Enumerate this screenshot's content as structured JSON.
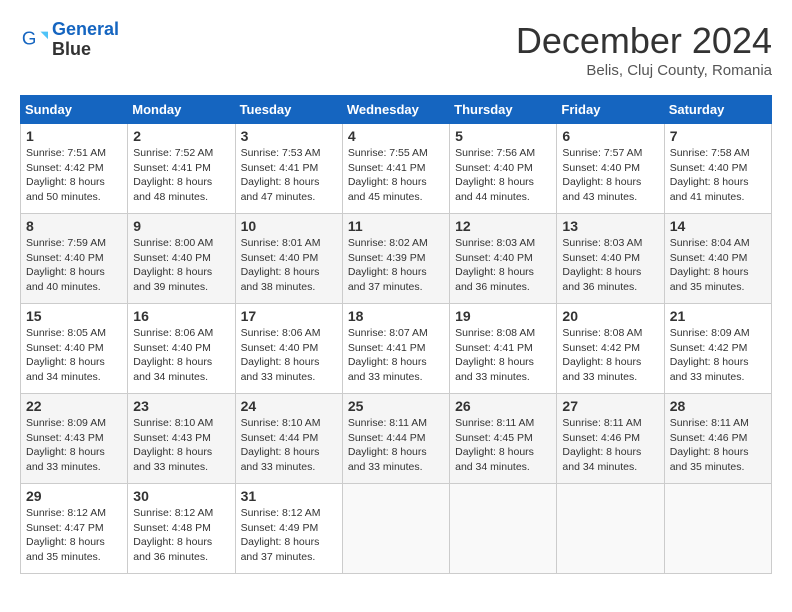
{
  "header": {
    "logo_line1": "General",
    "logo_line2": "Blue",
    "month": "December 2024",
    "location": "Belis, Cluj County, Romania"
  },
  "weekdays": [
    "Sunday",
    "Monday",
    "Tuesday",
    "Wednesday",
    "Thursday",
    "Friday",
    "Saturday"
  ],
  "weeks": [
    [
      {
        "day": "1",
        "sunrise": "7:51 AM",
        "sunset": "4:42 PM",
        "daylight": "8 hours and 50 minutes."
      },
      {
        "day": "2",
        "sunrise": "7:52 AM",
        "sunset": "4:41 PM",
        "daylight": "8 hours and 48 minutes."
      },
      {
        "day": "3",
        "sunrise": "7:53 AM",
        "sunset": "4:41 PM",
        "daylight": "8 hours and 47 minutes."
      },
      {
        "day": "4",
        "sunrise": "7:55 AM",
        "sunset": "4:41 PM",
        "daylight": "8 hours and 45 minutes."
      },
      {
        "day": "5",
        "sunrise": "7:56 AM",
        "sunset": "4:40 PM",
        "daylight": "8 hours and 44 minutes."
      },
      {
        "day": "6",
        "sunrise": "7:57 AM",
        "sunset": "4:40 PM",
        "daylight": "8 hours and 43 minutes."
      },
      {
        "day": "7",
        "sunrise": "7:58 AM",
        "sunset": "4:40 PM",
        "daylight": "8 hours and 41 minutes."
      }
    ],
    [
      {
        "day": "8",
        "sunrise": "7:59 AM",
        "sunset": "4:40 PM",
        "daylight": "8 hours and 40 minutes."
      },
      {
        "day": "9",
        "sunrise": "8:00 AM",
        "sunset": "4:40 PM",
        "daylight": "8 hours and 39 minutes."
      },
      {
        "day": "10",
        "sunrise": "8:01 AM",
        "sunset": "4:40 PM",
        "daylight": "8 hours and 38 minutes."
      },
      {
        "day": "11",
        "sunrise": "8:02 AM",
        "sunset": "4:39 PM",
        "daylight": "8 hours and 37 minutes."
      },
      {
        "day": "12",
        "sunrise": "8:03 AM",
        "sunset": "4:40 PM",
        "daylight": "8 hours and 36 minutes."
      },
      {
        "day": "13",
        "sunrise": "8:03 AM",
        "sunset": "4:40 PM",
        "daylight": "8 hours and 36 minutes."
      },
      {
        "day": "14",
        "sunrise": "8:04 AM",
        "sunset": "4:40 PM",
        "daylight": "8 hours and 35 minutes."
      }
    ],
    [
      {
        "day": "15",
        "sunrise": "8:05 AM",
        "sunset": "4:40 PM",
        "daylight": "8 hours and 34 minutes."
      },
      {
        "day": "16",
        "sunrise": "8:06 AM",
        "sunset": "4:40 PM",
        "daylight": "8 hours and 34 minutes."
      },
      {
        "day": "17",
        "sunrise": "8:06 AM",
        "sunset": "4:40 PM",
        "daylight": "8 hours and 33 minutes."
      },
      {
        "day": "18",
        "sunrise": "8:07 AM",
        "sunset": "4:41 PM",
        "daylight": "8 hours and 33 minutes."
      },
      {
        "day": "19",
        "sunrise": "8:08 AM",
        "sunset": "4:41 PM",
        "daylight": "8 hours and 33 minutes."
      },
      {
        "day": "20",
        "sunrise": "8:08 AM",
        "sunset": "4:42 PM",
        "daylight": "8 hours and 33 minutes."
      },
      {
        "day": "21",
        "sunrise": "8:09 AM",
        "sunset": "4:42 PM",
        "daylight": "8 hours and 33 minutes."
      }
    ],
    [
      {
        "day": "22",
        "sunrise": "8:09 AM",
        "sunset": "4:43 PM",
        "daylight": "8 hours and 33 minutes."
      },
      {
        "day": "23",
        "sunrise": "8:10 AM",
        "sunset": "4:43 PM",
        "daylight": "8 hours and 33 minutes."
      },
      {
        "day": "24",
        "sunrise": "8:10 AM",
        "sunset": "4:44 PM",
        "daylight": "8 hours and 33 minutes."
      },
      {
        "day": "25",
        "sunrise": "8:11 AM",
        "sunset": "4:44 PM",
        "daylight": "8 hours and 33 minutes."
      },
      {
        "day": "26",
        "sunrise": "8:11 AM",
        "sunset": "4:45 PM",
        "daylight": "8 hours and 34 minutes."
      },
      {
        "day": "27",
        "sunrise": "8:11 AM",
        "sunset": "4:46 PM",
        "daylight": "8 hours and 34 minutes."
      },
      {
        "day": "28",
        "sunrise": "8:11 AM",
        "sunset": "4:46 PM",
        "daylight": "8 hours and 35 minutes."
      }
    ],
    [
      {
        "day": "29",
        "sunrise": "8:12 AM",
        "sunset": "4:47 PM",
        "daylight": "8 hours and 35 minutes."
      },
      {
        "day": "30",
        "sunrise": "8:12 AM",
        "sunset": "4:48 PM",
        "daylight": "8 hours and 36 minutes."
      },
      {
        "day": "31",
        "sunrise": "8:12 AM",
        "sunset": "4:49 PM",
        "daylight": "8 hours and 37 minutes."
      },
      null,
      null,
      null,
      null
    ]
  ],
  "labels": {
    "sunrise": "Sunrise:",
    "sunset": "Sunset:",
    "daylight": "Daylight:"
  }
}
